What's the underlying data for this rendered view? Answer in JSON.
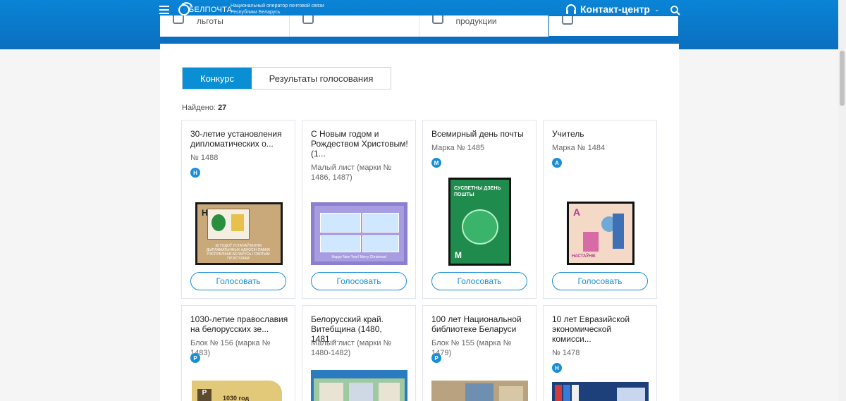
{
  "header": {
    "logo_text": "БЕЛПОЧТА",
    "tagline_1": "Национальный оператор почтовой связи",
    "tagline_2": "Республики Беларусь",
    "contact_label": "Контакт-центр"
  },
  "categories": [
    {
      "label": "льготы"
    },
    {
      "label": ""
    },
    {
      "label": "продукции"
    },
    {
      "label": ""
    }
  ],
  "tabs": {
    "contest": "Конкурс",
    "results": "Результаты голосования"
  },
  "found": {
    "label": "Найдено:",
    "count": "27"
  },
  "vote_label": "Голосовать",
  "cards": [
    {
      "title": "30-летие установления дипломатических о...",
      "sub": "№ 1488",
      "badge": "Н"
    },
    {
      "title": "С Новым годом и Рождеством Христовым! (1...",
      "sub": "Малый лист (марки № 1486, 1487)",
      "badge": ""
    },
    {
      "title": "Всемирный день почты",
      "sub": "Марка № 1485",
      "badge": "М",
      "stamp_text": "СУСВЕТНЫ ДЗЕНЬ ПОШТЫ"
    },
    {
      "title": "Учитель",
      "sub": "Марка № 1484",
      "badge": "А",
      "stamp_text": "НАСТАЎНІК"
    },
    {
      "title": "1030-летие православия на белорусских зе...",
      "sub": "Блок № 156 (марка № 1483)",
      "badge": "Р",
      "stamp_text": "1030 год"
    },
    {
      "title": "Белорусский край. Витебщина (1480, 1481,...",
      "sub": "Малый лист (марки № 1480-1482)",
      "badge": ""
    },
    {
      "title": "100 лет Национальной библиотеке Беларуси",
      "sub": "Блок № 155 (марка № 1479)",
      "badge": "Р"
    },
    {
      "title": "10 лет Евразийской экономической комисси...",
      "sub": "№ 1478",
      "badge": "Н"
    }
  ],
  "stamp_caption_1": "30 ГОДОЎ УСТАНАЎЛЕННЯ ДЫПЛАМАТЫЧНЫХ АДНОСІН ПАМІЖ РЭСПУБЛІКАЙ БЕЛАРУСЬ І СВЯТЫМ ПРЭСТОЛАМ",
  "stamp_caption_2": "Happy New Year! Merry Christmas!",
  "colors": {
    "brand": "#0b6fc0",
    "accent": "#1a8fd5"
  }
}
